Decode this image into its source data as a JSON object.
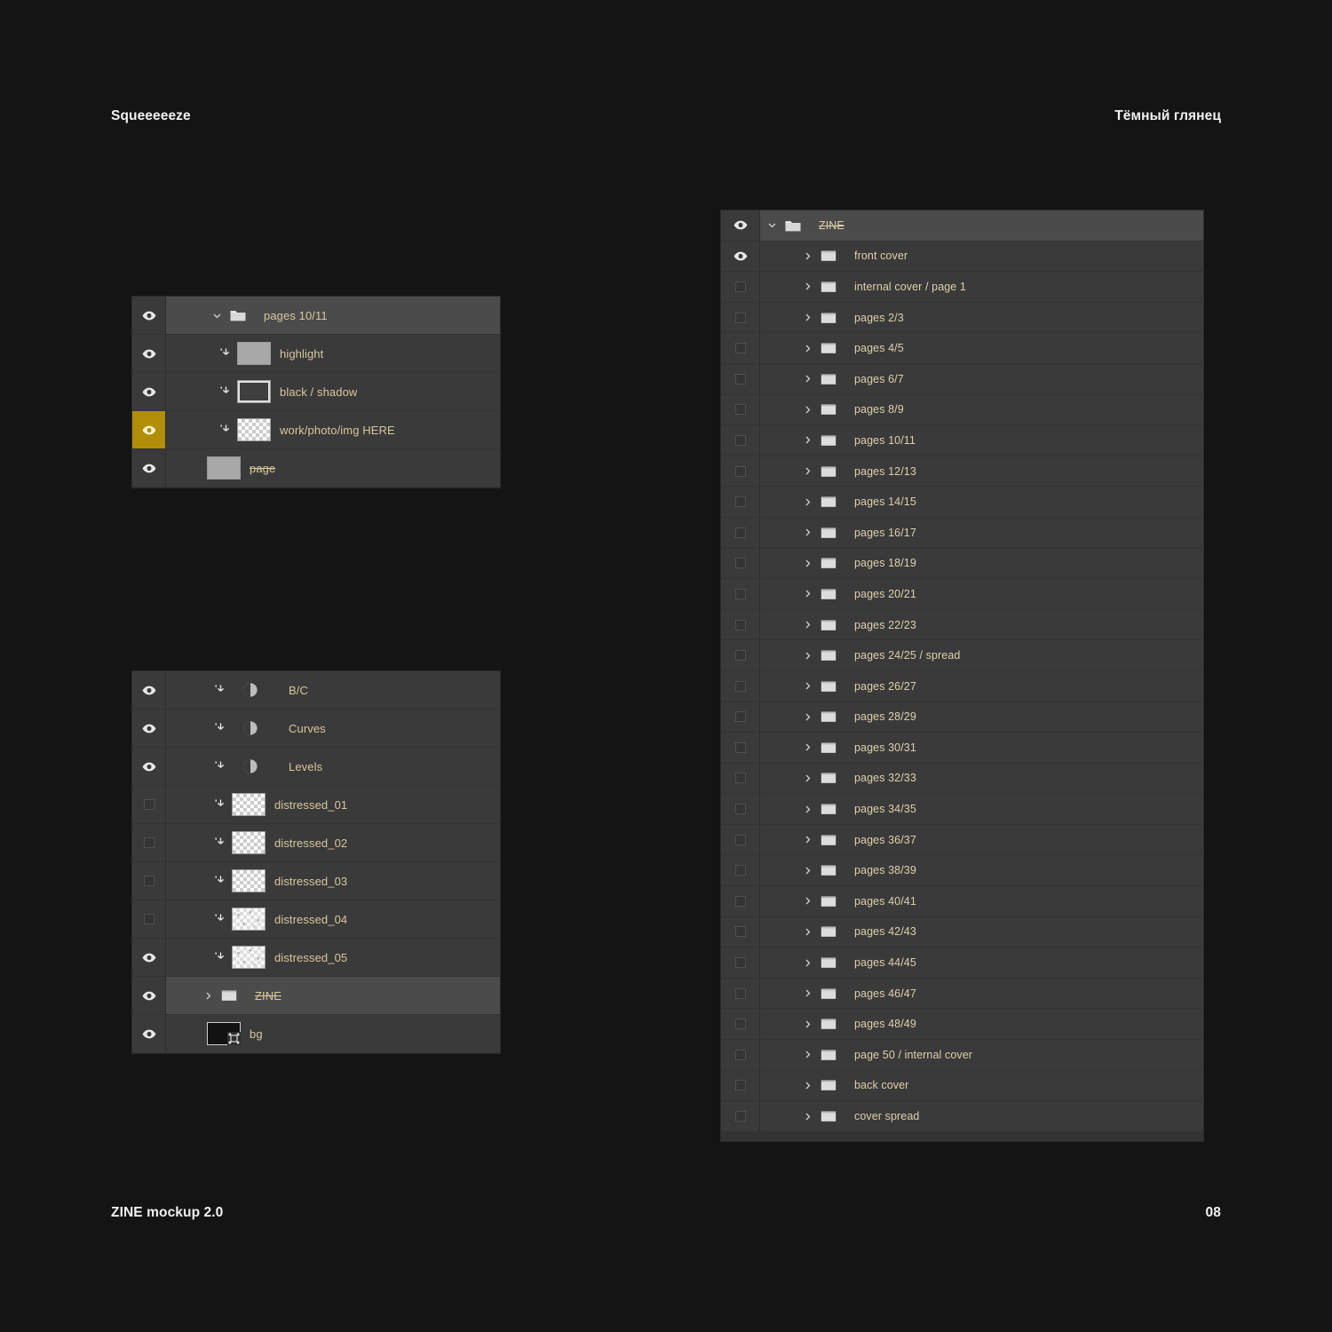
{
  "header": {
    "left_title": "Squeeeeeze",
    "right_title": "Тёмный глянец"
  },
  "footer": {
    "left_label": "ZINE mockup 2.0",
    "page_number": "08"
  },
  "colors": {
    "page_background": "#141414",
    "panel_background": "#333333",
    "row_background": "#3a3a3a",
    "row_selected": "#4b4b4b",
    "visibility_highlight": "#b18e08",
    "layer_name_text": "#d8c79f",
    "header_text": "#f2f2f2"
  },
  "panel_a": {
    "name": "pages-10-11-layers-panel",
    "rows": [
      {
        "label": "pages 10/11",
        "type": "group",
        "visible": true,
        "expanded": true,
        "highlight": false,
        "selected": false,
        "strike": false,
        "icon": "folder-icon",
        "indent": 0
      },
      {
        "label": "highlight",
        "type": "layer",
        "visible": true,
        "clipped": true,
        "highlight": false,
        "selected": false,
        "strike": false,
        "icon": "layer-thumbnail-gray",
        "indent": 1
      },
      {
        "label": "black / shadow",
        "type": "layer",
        "visible": true,
        "clipped": true,
        "highlight": false,
        "selected": false,
        "strike": false,
        "icon": "layer-thumbnail-dark",
        "indent": 1
      },
      {
        "label": "work/photo/img HERE",
        "type": "layer",
        "visible": true,
        "clipped": true,
        "highlight": true,
        "selected": false,
        "strike": false,
        "icon": "layer-thumbnail-transparent",
        "indent": 1
      },
      {
        "label": "page",
        "type": "layer",
        "visible": true,
        "clipped": false,
        "highlight": false,
        "selected": false,
        "strike": true,
        "icon": "layer-thumbnail-gray",
        "indent": 0
      }
    ]
  },
  "panel_b": {
    "name": "document-layers-panel",
    "rows": [
      {
        "label": "B/C",
        "type": "adjustment",
        "visible": true,
        "clipped": true,
        "selected": false,
        "strike": false,
        "icon": "adjustment-icon",
        "indent": 0
      },
      {
        "label": "Curves",
        "type": "adjustment",
        "visible": true,
        "clipped": true,
        "selected": false,
        "strike": false,
        "icon": "adjustment-icon",
        "indent": 0
      },
      {
        "label": "Levels",
        "type": "adjustment",
        "visible": true,
        "clipped": true,
        "selected": false,
        "strike": false,
        "icon": "adjustment-icon",
        "indent": 0
      },
      {
        "label": "distressed_01",
        "type": "layer",
        "visible": false,
        "clipped": true,
        "selected": false,
        "strike": false,
        "icon": "layer-thumbnail-transparent",
        "indent": 0
      },
      {
        "label": "distressed_02",
        "type": "layer",
        "visible": false,
        "clipped": true,
        "selected": false,
        "strike": false,
        "icon": "layer-thumbnail-transparent",
        "indent": 0
      },
      {
        "label": "distressed_03",
        "type": "layer",
        "visible": false,
        "clipped": true,
        "selected": false,
        "strike": false,
        "icon": "layer-thumbnail-transparent",
        "indent": 0
      },
      {
        "label": "distressed_04",
        "type": "layer",
        "visible": false,
        "clipped": true,
        "selected": false,
        "strike": false,
        "icon": "layer-thumbnail-grain",
        "indent": 0
      },
      {
        "label": "distressed_05",
        "type": "layer",
        "visible": true,
        "clipped": true,
        "selected": false,
        "strike": false,
        "icon": "layer-thumbnail-grain",
        "indent": 0
      },
      {
        "label": "ZINE",
        "type": "group",
        "visible": true,
        "clipped": false,
        "selected": true,
        "strike": true,
        "icon": "folder-icon",
        "indent": 0
      },
      {
        "label": "bg",
        "type": "layer",
        "visible": true,
        "clipped": false,
        "selected": false,
        "strike": false,
        "icon": "layer-thumbnail-black",
        "indent": 0
      }
    ]
  },
  "panel_c": {
    "name": "zine-group-tree-panel",
    "rows": [
      {
        "label": "ZINE",
        "type": "group",
        "visible": true,
        "expanded": true,
        "selected": true,
        "strike": true,
        "indent": 0
      },
      {
        "label": "front cover",
        "type": "group",
        "visible": true,
        "expanded": false,
        "selected": false,
        "strike": false,
        "indent": 1
      },
      {
        "label": "internal cover / page 1",
        "type": "group",
        "visible": false,
        "expanded": false,
        "selected": false,
        "strike": false,
        "indent": 1
      },
      {
        "label": "pages 2/3",
        "type": "group",
        "visible": false,
        "expanded": false,
        "selected": false,
        "strike": false,
        "indent": 1
      },
      {
        "label": "pages 4/5",
        "type": "group",
        "visible": false,
        "expanded": false,
        "selected": false,
        "strike": false,
        "indent": 1
      },
      {
        "label": "pages 6/7",
        "type": "group",
        "visible": false,
        "expanded": false,
        "selected": false,
        "strike": false,
        "indent": 1
      },
      {
        "label": "pages 8/9",
        "type": "group",
        "visible": false,
        "expanded": false,
        "selected": false,
        "strike": false,
        "indent": 1
      },
      {
        "label": "pages 10/11",
        "type": "group",
        "visible": false,
        "expanded": false,
        "selected": false,
        "strike": false,
        "indent": 1
      },
      {
        "label": "pages 12/13",
        "type": "group",
        "visible": false,
        "expanded": false,
        "selected": false,
        "strike": false,
        "indent": 1
      },
      {
        "label": "pages 14/15",
        "type": "group",
        "visible": false,
        "expanded": false,
        "selected": false,
        "strike": false,
        "indent": 1
      },
      {
        "label": "pages 16/17",
        "type": "group",
        "visible": false,
        "expanded": false,
        "selected": false,
        "strike": false,
        "indent": 1
      },
      {
        "label": "pages 18/19",
        "type": "group",
        "visible": false,
        "expanded": false,
        "selected": false,
        "strike": false,
        "indent": 1
      },
      {
        "label": "pages 20/21",
        "type": "group",
        "visible": false,
        "expanded": false,
        "selected": false,
        "strike": false,
        "indent": 1
      },
      {
        "label": "pages 22/23",
        "type": "group",
        "visible": false,
        "expanded": false,
        "selected": false,
        "strike": false,
        "indent": 1
      },
      {
        "label": "pages 24/25 / spread",
        "type": "group",
        "visible": false,
        "expanded": false,
        "selected": false,
        "strike": false,
        "indent": 1
      },
      {
        "label": "pages 26/27",
        "type": "group",
        "visible": false,
        "expanded": false,
        "selected": false,
        "strike": false,
        "indent": 1
      },
      {
        "label": "pages 28/29",
        "type": "group",
        "visible": false,
        "expanded": false,
        "selected": false,
        "strike": false,
        "indent": 1
      },
      {
        "label": "pages 30/31",
        "type": "group",
        "visible": false,
        "expanded": false,
        "selected": false,
        "strike": false,
        "indent": 1
      },
      {
        "label": "pages 32/33",
        "type": "group",
        "visible": false,
        "expanded": false,
        "selected": false,
        "strike": false,
        "indent": 1
      },
      {
        "label": "pages 34/35",
        "type": "group",
        "visible": false,
        "expanded": false,
        "selected": false,
        "strike": false,
        "indent": 1
      },
      {
        "label": "pages 36/37",
        "type": "group",
        "visible": false,
        "expanded": false,
        "selected": false,
        "strike": false,
        "indent": 1
      },
      {
        "label": "pages 38/39",
        "type": "group",
        "visible": false,
        "expanded": false,
        "selected": false,
        "strike": false,
        "indent": 1
      },
      {
        "label": "pages 40/41",
        "type": "group",
        "visible": false,
        "expanded": false,
        "selected": false,
        "strike": false,
        "indent": 1
      },
      {
        "label": "pages 42/43",
        "type": "group",
        "visible": false,
        "expanded": false,
        "selected": false,
        "strike": false,
        "indent": 1
      },
      {
        "label": "pages 44/45",
        "type": "group",
        "visible": false,
        "expanded": false,
        "selected": false,
        "strike": false,
        "indent": 1
      },
      {
        "label": "pages 46/47",
        "type": "group",
        "visible": false,
        "expanded": false,
        "selected": false,
        "strike": false,
        "indent": 1
      },
      {
        "label": "pages 48/49",
        "type": "group",
        "visible": false,
        "expanded": false,
        "selected": false,
        "strike": false,
        "indent": 1
      },
      {
        "label": "page 50 / internal cover",
        "type": "group",
        "visible": false,
        "expanded": false,
        "selected": false,
        "strike": false,
        "indent": 1
      },
      {
        "label": "back cover",
        "type": "group",
        "visible": false,
        "expanded": false,
        "selected": false,
        "strike": false,
        "indent": 1
      },
      {
        "label": "cover spread",
        "type": "group",
        "visible": false,
        "expanded": false,
        "selected": false,
        "strike": false,
        "indent": 1
      }
    ]
  }
}
